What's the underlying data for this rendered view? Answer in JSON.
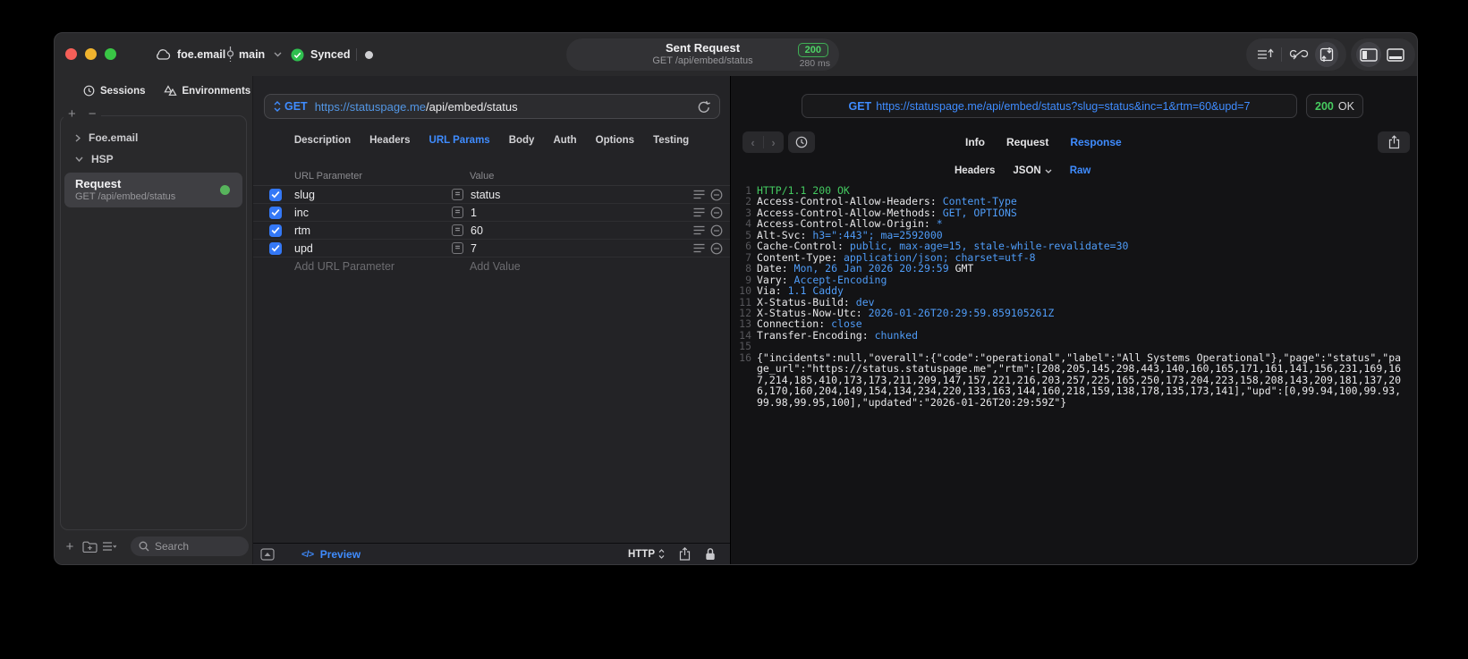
{
  "colors": {
    "accent_blue": "#3F8CFF",
    "status_green": "#3FCA5A",
    "checkbox_blue": "#3478F6",
    "selected_row": "#3F3F43"
  },
  "titlebar": {
    "project": "foe.email",
    "branch": "main",
    "sync_status": "Synced",
    "request_title": "Sent Request",
    "request_subtitle": "GET /api/embed/status",
    "status_code": "200",
    "duration": "280 ms"
  },
  "sidebar": {
    "tabs": [
      {
        "label": "Sessions"
      },
      {
        "label": "Environments"
      }
    ],
    "tree": [
      {
        "label": "Foe.email"
      },
      {
        "label": "HSP"
      }
    ],
    "selected_request": {
      "title": "Request",
      "subtitle": "GET /api/embed/status"
    },
    "search_placeholder": "Search"
  },
  "request_pane": {
    "method": "GET",
    "url_host": "https://statuspage.me",
    "url_path": "/api/embed/status",
    "tabs": [
      "Description",
      "Headers",
      "URL Params",
      "Body",
      "Auth",
      "Options",
      "Testing"
    ],
    "active_tab": "URL Params",
    "params": {
      "col_name": "URL Parameter",
      "col_value": "Value",
      "eq": "=",
      "rows": [
        {
          "name": "slug",
          "value": "status",
          "enabled": true
        },
        {
          "name": "inc",
          "value": "1",
          "enabled": true
        },
        {
          "name": "rtm",
          "value": "60",
          "enabled": true
        },
        {
          "name": "upd",
          "value": "7",
          "enabled": true
        }
      ],
      "add_name_placeholder": "Add URL Parameter",
      "add_value_placeholder": "Add Value"
    },
    "footer": {
      "code_glyph": "</>",
      "preview_label": "Preview",
      "protocol": "HTTP"
    }
  },
  "response_pane": {
    "method": "GET",
    "url": "https://statuspage.me/api/embed/status?slug=status&inc=1&rtm=60&upd=7",
    "status_code": "200",
    "status_text": "OK",
    "back_arrow": "‹",
    "forward_arrow": "›",
    "tabs": [
      "Info",
      "Request",
      "Response"
    ],
    "active_tab": "Response",
    "subtabs": [
      "Headers",
      "JSON",
      "Raw"
    ],
    "active_subtab": "Raw",
    "body_lines": [
      {
        "num": "1",
        "segments": [
          {
            "color": "green",
            "text": "HTTP/1.1 200 OK"
          }
        ]
      },
      {
        "num": "2",
        "segments": [
          {
            "color": "plain",
            "text": "Access-Control-Allow-Headers: "
          },
          {
            "color": "blue",
            "text": "Content-Type"
          }
        ]
      },
      {
        "num": "3",
        "segments": [
          {
            "color": "plain",
            "text": "Access-Control-Allow-Methods: "
          },
          {
            "color": "blue",
            "text": "GET, OPTIONS"
          }
        ]
      },
      {
        "num": "4",
        "segments": [
          {
            "color": "plain",
            "text": "Access-Control-Allow-Origin: "
          },
          {
            "color": "blue",
            "text": "*"
          }
        ]
      },
      {
        "num": "5",
        "segments": [
          {
            "color": "plain",
            "text": "Alt-Svc: "
          },
          {
            "color": "blue",
            "text": "h3=\":443\"; ma=2592000"
          }
        ]
      },
      {
        "num": "6",
        "segments": [
          {
            "color": "plain",
            "text": "Cache-Control: "
          },
          {
            "color": "blue",
            "text": "public, max-age=15, stale-while-revalidate=30"
          }
        ]
      },
      {
        "num": "7",
        "segments": [
          {
            "color": "plain",
            "text": "Content-Type: "
          },
          {
            "color": "blue",
            "text": "application/json; charset=utf-8"
          }
        ]
      },
      {
        "num": "8",
        "segments": [
          {
            "color": "plain",
            "text": "Date: "
          },
          {
            "color": "blue",
            "text": "Mon, 26 Jan 2026 20:29:59"
          },
          {
            "color": "plain",
            "text": " GMT"
          }
        ]
      },
      {
        "num": "9",
        "segments": [
          {
            "color": "plain",
            "text": "Vary: "
          },
          {
            "color": "blue",
            "text": "Accept-Encoding"
          }
        ]
      },
      {
        "num": "10",
        "segments": [
          {
            "color": "plain",
            "text": "Via: "
          },
          {
            "color": "blue",
            "text": "1.1 Caddy"
          }
        ]
      },
      {
        "num": "11",
        "segments": [
          {
            "color": "plain",
            "text": "X-Status-Build: "
          },
          {
            "color": "blue",
            "text": "dev"
          }
        ]
      },
      {
        "num": "12",
        "segments": [
          {
            "color": "plain",
            "text": "X-Status-Now-Utc: "
          },
          {
            "color": "blue",
            "text": "2026-01-26T20:29:59.859105261Z"
          }
        ]
      },
      {
        "num": "13",
        "segments": [
          {
            "color": "plain",
            "text": "Connection: "
          },
          {
            "color": "blue",
            "text": "close"
          }
        ]
      },
      {
        "num": "14",
        "segments": [
          {
            "color": "plain",
            "text": "Transfer-Encoding: "
          },
          {
            "color": "blue",
            "text": "chunked"
          }
        ]
      },
      {
        "num": "15",
        "segments": []
      },
      {
        "num": "16",
        "segments": [
          {
            "color": "plain",
            "text": "{\"incidents\":null,\"overall\":{\"code\":\"operational\",\"label\":\"All Systems Operational\"},\"page\":\"status\",\"page_url\":\"https://status.statuspage.me\",\"rtm\":[208,205,145,298,443,140,160,165,171,161,141,156,231,169,167,214,185,410,173,173,211,209,147,157,221,216,203,257,225,165,250,173,204,223,158,208,143,209,181,137,206,170,160,204,149,154,134,234,220,133,163,144,160,218,159,138,178,135,173,141],\"upd\":[0,99.94,100,99.93,99.98,99.95,100],\"updated\":\"2026-01-26T20:29:59Z\"}"
          }
        ]
      }
    ]
  }
}
